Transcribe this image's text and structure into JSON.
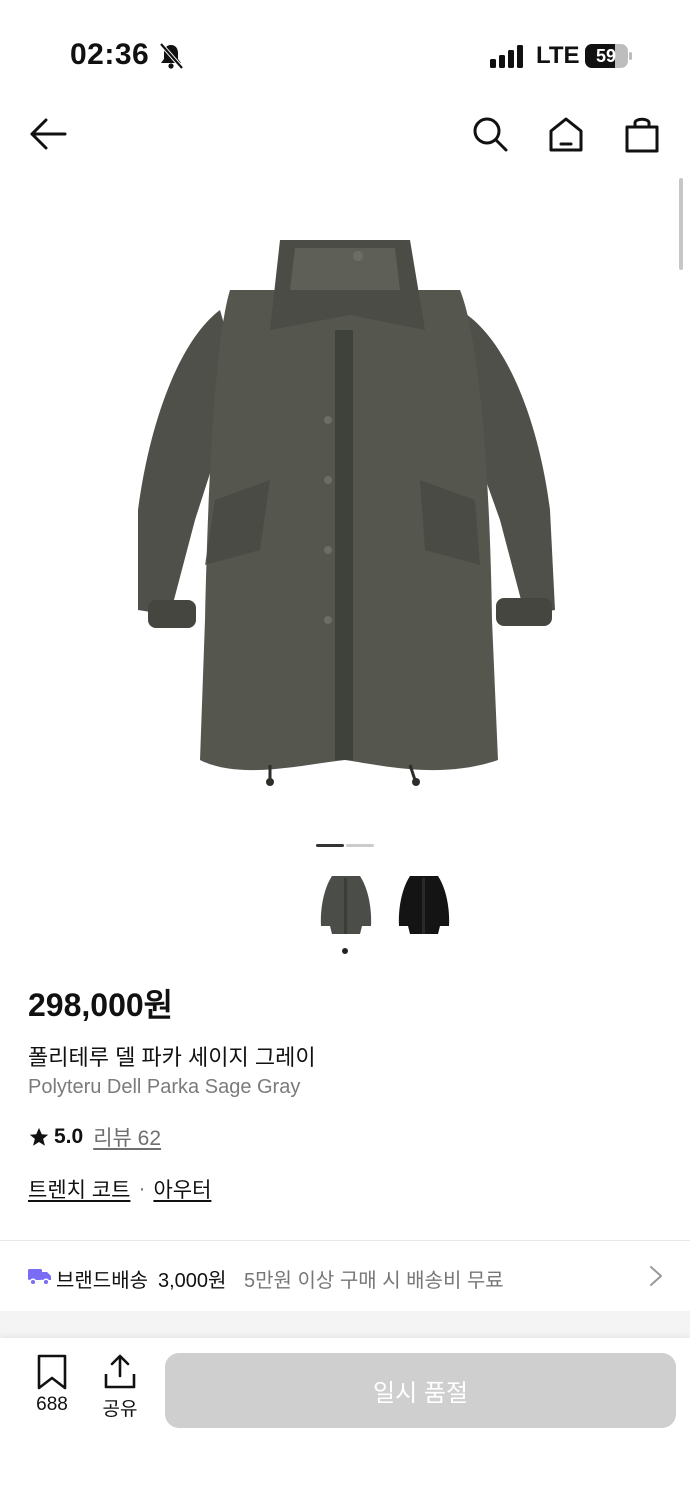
{
  "status_bar": {
    "time": "02:36",
    "network": "LTE",
    "battery": "59"
  },
  "product": {
    "price": "298,000원",
    "name_ko": "폴리테루 델 파카 세이지 그레이",
    "name_en": "Polyteru Dell Parka Sage Gray",
    "rating": "5.0",
    "review_label": "리뷰 62",
    "categories": [
      "트렌치 코트",
      "아우터"
    ],
    "category_separator": "·",
    "image_count": 2,
    "current_image": 1,
    "thumbnails": [
      {
        "name": "sage-gray-parka",
        "color": "#4b4e48"
      },
      {
        "name": "black-parka",
        "color": "#141414"
      }
    ]
  },
  "shipping": {
    "label": "브랜드배송",
    "fee": "3,000원",
    "note": "5만원 이상 구매 시 배송비 무료"
  },
  "bottom_bar": {
    "bookmark_count": "688",
    "share_label": "공유",
    "buy_button_label": "일시 품절"
  },
  "colors": {
    "button_disabled": "#cfcfcf",
    "truck_icon": "#7b6cf6",
    "coat": "#4d4f49"
  }
}
